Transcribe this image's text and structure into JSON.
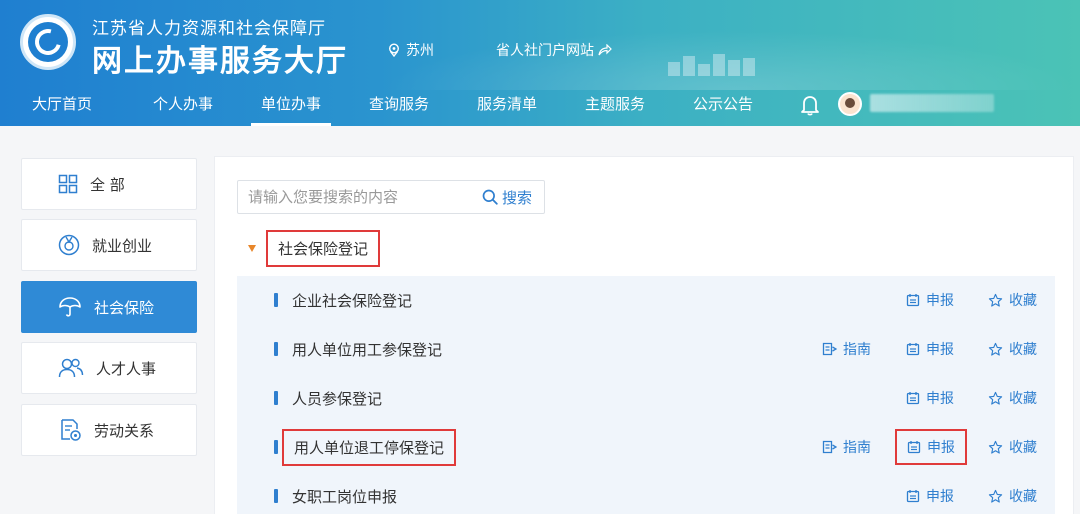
{
  "header": {
    "org_name": "江苏省人力资源和社会保障厅",
    "site_title": "网上办事服务大厅",
    "location": "苏州",
    "portal_link": "省人社门户网站",
    "brand_color": "#1f7fd0"
  },
  "nav": {
    "items": [
      {
        "label": "大厅首页",
        "active": false
      },
      {
        "label": "个人办事",
        "active": false
      },
      {
        "label": "单位办事",
        "active": true
      },
      {
        "label": "查询服务",
        "active": false
      },
      {
        "label": "服务清单",
        "active": false
      },
      {
        "label": "主题服务",
        "active": false
      },
      {
        "label": "公示公告",
        "active": false
      }
    ],
    "icons": [
      "bell-icon",
      "user-avatar"
    ]
  },
  "sidebar": {
    "items": [
      {
        "label": "全 部",
        "icon": "grid-icon",
        "active": false
      },
      {
        "label": "就业创业",
        "icon": "medal-icon",
        "active": false
      },
      {
        "label": "社会保险",
        "icon": "umbrella-icon",
        "active": true
      },
      {
        "label": "人才人事",
        "icon": "people-icon",
        "active": false
      },
      {
        "label": "劳动关系",
        "icon": "document-icon",
        "active": false
      }
    ]
  },
  "search": {
    "placeholder": "请输入您要搜索的内容",
    "value": "",
    "button_label": "搜索"
  },
  "section": {
    "title": "社会保险登记"
  },
  "services": {
    "guide_label": "指南",
    "apply_label": "申报",
    "favorite_label": "收藏",
    "items": [
      {
        "name": "企业社会保险登记",
        "has_guide": false
      },
      {
        "name": "用人单位用工参保登记",
        "has_guide": true
      },
      {
        "name": "人员参保登记",
        "has_guide": false
      },
      {
        "name": "用人单位退工停保登记",
        "has_guide": true
      },
      {
        "name": "女职工岗位申报",
        "has_guide": false
      }
    ]
  },
  "colors": {
    "accent": "#2f7fcf",
    "highlight_box": "#e03a3a",
    "caret": "#e8862a",
    "active_sidebar": "#2f8ad6"
  }
}
